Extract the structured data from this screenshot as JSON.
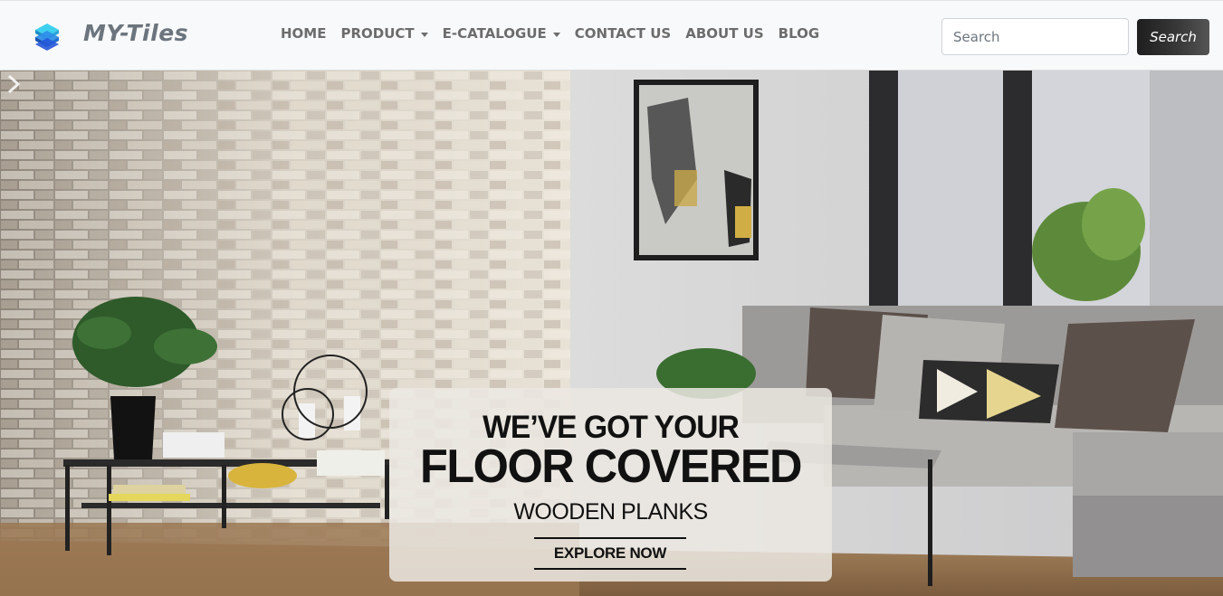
{
  "brand": {
    "name": "MY-Tiles",
    "logo_icon": "stacked-layers-icon"
  },
  "nav": {
    "items": [
      {
        "label": "HOME",
        "dropdown": false
      },
      {
        "label": "PRODUCT",
        "dropdown": true
      },
      {
        "label": "E-CATALOGUE",
        "dropdown": true
      },
      {
        "label": "CONTACT US",
        "dropdown": false
      },
      {
        "label": "ABOUT US",
        "dropdown": false
      },
      {
        "label": "BLOG",
        "dropdown": false
      }
    ]
  },
  "search": {
    "placeholder": "Search",
    "value": "",
    "button_label": "Search"
  },
  "hero": {
    "headline_1": "WE’VE GOT YOUR",
    "headline_2": "FLOOR COVERED",
    "subline": "WOODEN PLANKS",
    "cta_label": "EXPLORE NOW",
    "next_icon": "chevron-right-icon"
  },
  "colors": {
    "navbar_bg": "#f8f9fa",
    "nav_text": "#6c6c6c",
    "button_dark": "#343a40"
  }
}
